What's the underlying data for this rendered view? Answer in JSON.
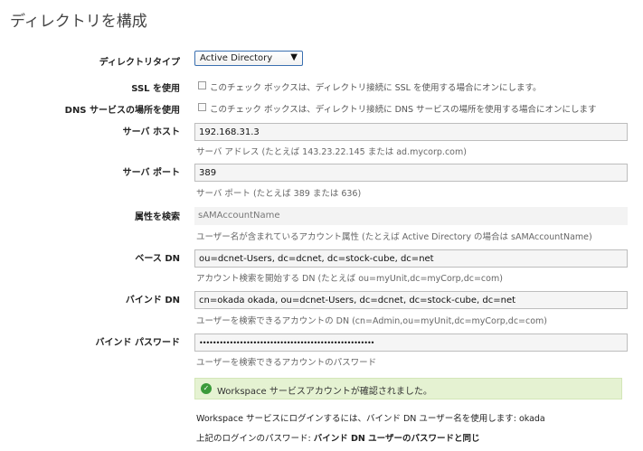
{
  "page": {
    "title": "ディレクトリを構成"
  },
  "form": {
    "directory_type": {
      "label": "ディレクトリタイプ",
      "value": "Active Directory"
    },
    "ssl": {
      "label": "SSL を使用",
      "description": "このチェック ボックスは、ディレクトリ接続に SSL を使用する場合にオンにします。",
      "checked": false
    },
    "dns": {
      "label": "DNS サービスの場所を使用",
      "description": "このチェック ボックスは、ディレクトリ接続に DNS サービスの場所を使用する場合にオンにします",
      "checked": false
    },
    "server_host": {
      "label": "サーバ ホスト",
      "value": "192.168.31.3",
      "hint": "サーバ アドレス (たとえば 143.23.22.145 または ad.mycorp.com)"
    },
    "server_port": {
      "label": "サーバ ポート",
      "value": "389",
      "hint": "サーバ ポート (たとえば 389 または 636)"
    },
    "search_attr": {
      "label": "属性を検索",
      "value": "sAMAccountName",
      "hint": "ユーザー名が含まれているアカウント属性 (たとえば Active Directory の場合は sAMAccountName)"
    },
    "base_dn": {
      "label": "ベース DN",
      "value": "ou=dcnet-Users, dc=dcnet, dc=stock-cube, dc=net",
      "hint": "アカウント検索を開始する DN (たとえば ou=myUnit,dc=myCorp,dc=com)"
    },
    "bind_dn": {
      "label": "バインド DN",
      "value": "cn=okada okada, ou=dcnet-Users, dc=dcnet, dc=stock-cube, dc=net",
      "hint": "ユーザーを検索できるアカウントの DN (cn=Admin,ou=myUnit,dc=myCorp,dc=com)"
    },
    "bind_password": {
      "label": "バインド パスワード",
      "value": "••••••••••••••••••••••••••••••••••••••••••••••••••••",
      "hint": "ユーザーを検索できるアカウントのパスワード"
    }
  },
  "status": {
    "success_message": "Workspace サービスアカウントが確認されました。",
    "login_info": "Workspace サービスにログインするには、バインド DN ユーザー名を使用します: okada",
    "password_prefix": "上記のログインのパスワード: ",
    "password_bold": "バインド DN ユーザーのパスワードと同じ"
  },
  "colors": {
    "success_bg": "#e5f2d2",
    "success_icon": "#3a9a3a",
    "select_border": "#3a6fb0"
  },
  "icons": {
    "success": "check-circle-icon",
    "dropdown": "triangle-down-icon"
  }
}
